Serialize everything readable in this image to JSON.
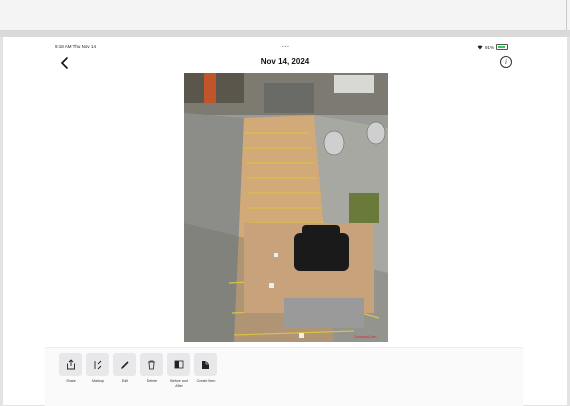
{
  "status_bar": {
    "time": "9:18 AM  Thu Nov 14",
    "dots": "•••",
    "battery": "91%"
  },
  "header": {
    "title": "Nov 14, 2024",
    "info_glyph": "i"
  },
  "photo": {
    "description_icon": "construction-site-photo",
    "watermark": "CompanyCam"
  },
  "toolbar": {
    "items": [
      {
        "label": "Share",
        "icon": "share-icon"
      },
      {
        "label": "Markup",
        "icon": "markup-icon"
      },
      {
        "label": "Edit",
        "icon": "pencil-icon"
      },
      {
        "label": "Delete",
        "icon": "trash-icon"
      },
      {
        "label": "Before and After",
        "icon": "before-after-icon"
      },
      {
        "label": "Create Item",
        "icon": "create-item-icon"
      }
    ]
  },
  "colors": {
    "accent": "#34c759",
    "toolbar_btn": "#e8e8ea"
  }
}
